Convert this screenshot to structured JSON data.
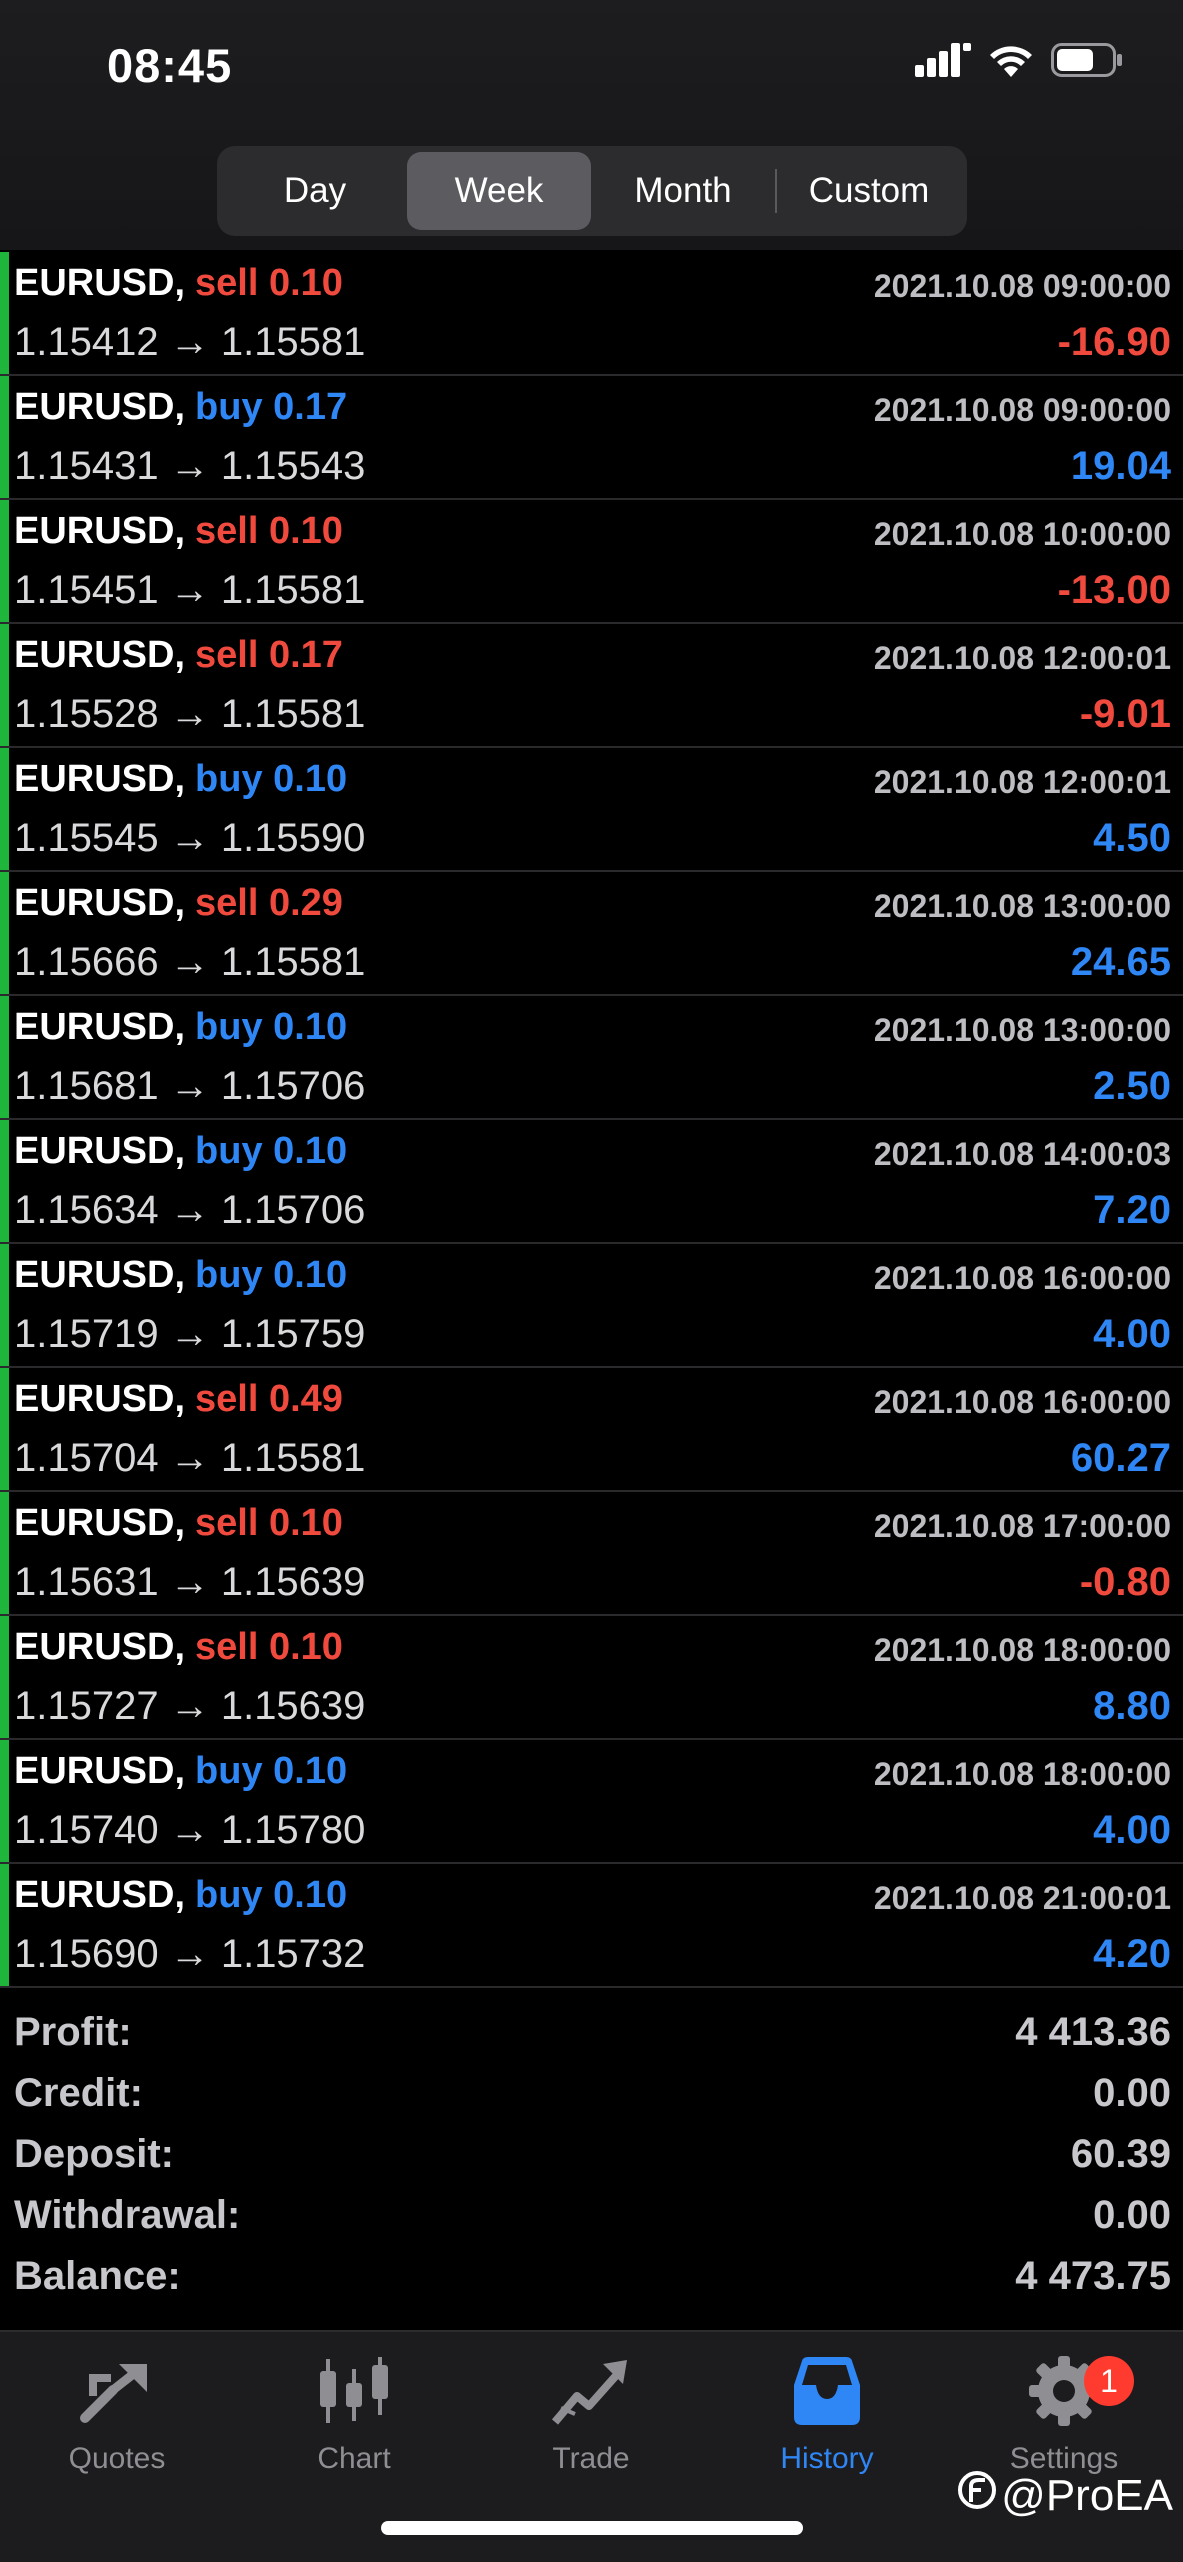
{
  "status": {
    "time": "08:45"
  },
  "tabs": [
    "Day",
    "Week",
    "Month",
    "Custom"
  ],
  "active_tab": "Week",
  "deals": [
    {
      "symbol": "EURUSD,",
      "type": "sell",
      "volume": "0.10",
      "time": "2021.10.08 09:00:00",
      "open": "1.15412",
      "close": "1.15581",
      "profit": "-16.90"
    },
    {
      "symbol": "EURUSD,",
      "type": "buy",
      "volume": "0.17",
      "time": "2021.10.08 09:00:00",
      "open": "1.15431",
      "close": "1.15543",
      "profit": "19.04"
    },
    {
      "symbol": "EURUSD,",
      "type": "sell",
      "volume": "0.10",
      "time": "2021.10.08 10:00:00",
      "open": "1.15451",
      "close": "1.15581",
      "profit": "-13.00"
    },
    {
      "symbol": "EURUSD,",
      "type": "sell",
      "volume": "0.17",
      "time": "2021.10.08 12:00:01",
      "open": "1.15528",
      "close": "1.15581",
      "profit": "-9.01"
    },
    {
      "symbol": "EURUSD,",
      "type": "buy",
      "volume": "0.10",
      "time": "2021.10.08 12:00:01",
      "open": "1.15545",
      "close": "1.15590",
      "profit": "4.50"
    },
    {
      "symbol": "EURUSD,",
      "type": "sell",
      "volume": "0.29",
      "time": "2021.10.08 13:00:00",
      "open": "1.15666",
      "close": "1.15581",
      "profit": "24.65"
    },
    {
      "symbol": "EURUSD,",
      "type": "buy",
      "volume": "0.10",
      "time": "2021.10.08 13:00:00",
      "open": "1.15681",
      "close": "1.15706",
      "profit": "2.50"
    },
    {
      "symbol": "EURUSD,",
      "type": "buy",
      "volume": "0.10",
      "time": "2021.10.08 14:00:03",
      "open": "1.15634",
      "close": "1.15706",
      "profit": "7.20"
    },
    {
      "symbol": "EURUSD,",
      "type": "buy",
      "volume": "0.10",
      "time": "2021.10.08 16:00:00",
      "open": "1.15719",
      "close": "1.15759",
      "profit": "4.00"
    },
    {
      "symbol": "EURUSD,",
      "type": "sell",
      "volume": "0.49",
      "time": "2021.10.08 16:00:00",
      "open": "1.15704",
      "close": "1.15581",
      "profit": "60.27"
    },
    {
      "symbol": "EURUSD,",
      "type": "sell",
      "volume": "0.10",
      "time": "2021.10.08 17:00:00",
      "open": "1.15631",
      "close": "1.15639",
      "profit": "-0.80"
    },
    {
      "symbol": "EURUSD,",
      "type": "sell",
      "volume": "0.10",
      "time": "2021.10.08 18:00:00",
      "open": "1.15727",
      "close": "1.15639",
      "profit": "8.80"
    },
    {
      "symbol": "EURUSD,",
      "type": "buy",
      "volume": "0.10",
      "time": "2021.10.08 18:00:00",
      "open": "1.15740",
      "close": "1.15780",
      "profit": "4.00"
    },
    {
      "symbol": "EURUSD,",
      "type": "buy",
      "volume": "0.10",
      "time": "2021.10.08 21:00:01",
      "open": "1.15690",
      "close": "1.15732",
      "profit": "4.20"
    }
  ],
  "summary": {
    "profit_label": "Profit:",
    "profit": "4 413.36",
    "credit_label": "Credit:",
    "credit": "0.00",
    "deposit_label": "Deposit:",
    "deposit": "60.39",
    "withdrawal_label": "Withdrawal:",
    "withdrawal": "0.00",
    "balance_label": "Balance:",
    "balance": "4 473.75"
  },
  "nav": {
    "quotes": "Quotes",
    "chart": "Chart",
    "trade": "Trade",
    "history": "History",
    "settings": "Settings",
    "settings_badge": "1"
  },
  "watermark": "@ProEA",
  "colors": {
    "sell": "#f04a3e",
    "buy": "#2f86f5",
    "accent": "#2f86f5",
    "row_marker": "#1fb43c"
  }
}
